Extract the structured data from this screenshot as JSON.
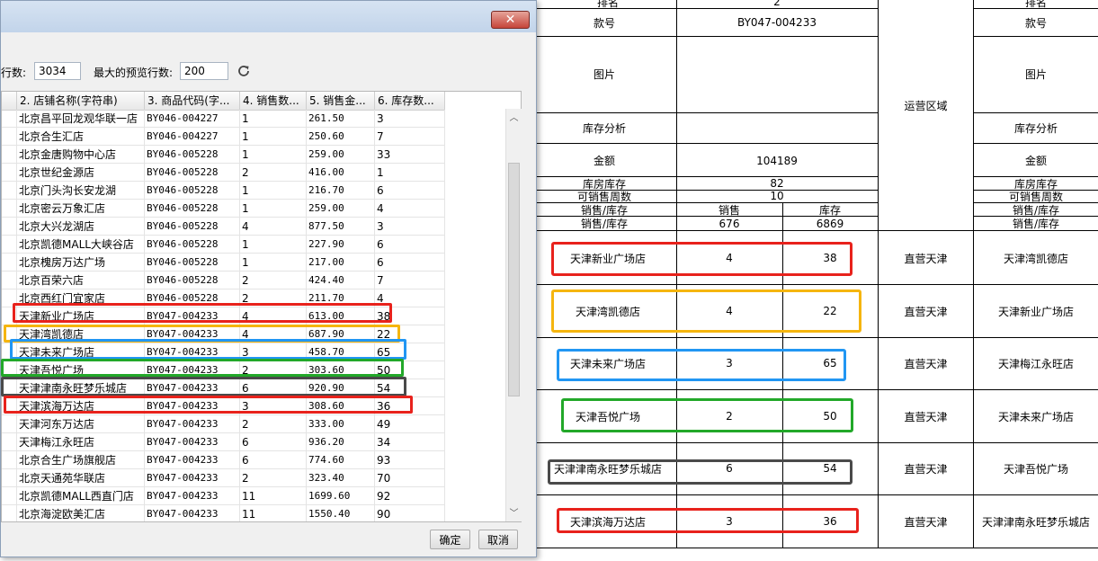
{
  "sheet": {
    "top_row_label": "排名",
    "top_row_value": "2",
    "right_top_label": "排名",
    "model_label": "款号",
    "model_value": "BY047-004233",
    "right_model_label": "款号",
    "picture_label": "图片",
    "right_picture_label": "图片",
    "region_label": "运营区域",
    "stock_analysis_label": "库存分析",
    "right_stock_analysis_label": "库存分析",
    "amount_label": "金额",
    "amount_value": "104189",
    "right_amount_label": "金额",
    "warehouse_stock_label": "库房库存",
    "warehouse_stock_value": "82",
    "right_warehouse_stock_label": "库房库存",
    "weeks_label": "可销售周数",
    "weeks_value": "10",
    "right_weeks_label": "可销售周数",
    "sales_stock_label_1": "销售/库存",
    "sales_header": "销售",
    "stock_header": "库存",
    "right_sales_stock_label_1": "销售/库存",
    "sales_stock_label_2": "销售/库存",
    "sales_total": "676",
    "stock_total": "6869",
    "right_sales_stock_label_2": "销售/库存",
    "stores": [
      {
        "name": "天津新业广场店",
        "sales": "4",
        "stock": "38",
        "region": "直营天津",
        "right": "天津湾凯德店",
        "color": "#e8221c"
      },
      {
        "name": "天津湾凯德店",
        "sales": "4",
        "stock": "22",
        "region": "直营天津",
        "right": "天津新业广场店",
        "color": "#f5b50f"
      },
      {
        "name": "天津未来广场店",
        "sales": "3",
        "stock": "65",
        "region": "直营天津",
        "right": "天津梅江永旺店",
        "color": "#2196f3"
      },
      {
        "name": "天津吾悦广场",
        "sales": "2",
        "stock": "50",
        "region": "直营天津",
        "right": "天津未来广场店",
        "color": "#22a829"
      },
      {
        "name": "天津津南永旺梦乐城店",
        "sales": "6",
        "stock": "54",
        "region": "直营天津",
        "right": "天津吾悦广场",
        "color": "#4a4a4a"
      },
      {
        "name": "天津滨海万达店",
        "sales": "3",
        "stock": "36",
        "region": "直营天津",
        "right": "天津津南永旺梦乐城店",
        "color": "#e8221c"
      }
    ]
  },
  "dialog": {
    "close_label": "✕",
    "rows_label": "行数:",
    "rows_value": "3034",
    "max_preview_label": "最大的预览行数:",
    "max_preview_value": "200",
    "columns": [
      "",
      "2. 店铺名称(字符串)",
      "3. 商品代码(字...",
      "4. 销售数...",
      "5. 销售金...",
      "6. 库存数..."
    ],
    "rows": [
      [
        "北京昌平回龙观华联一店",
        "BY046-004227",
        "1",
        "261.50",
        "3"
      ],
      [
        "北京合生汇店",
        "BY046-004227",
        "1",
        "250.60",
        "7"
      ],
      [
        "北京金唐购物中心店",
        "BY046-005228",
        "1",
        "259.00",
        "33"
      ],
      [
        "北京世纪金源店",
        "BY046-005228",
        "2",
        "416.00",
        "1"
      ],
      [
        "北京门头沟长安龙湖",
        "BY046-005228",
        "1",
        "216.70",
        "6"
      ],
      [
        "北京密云万象汇店",
        "BY046-005228",
        "1",
        "259.00",
        "4"
      ],
      [
        "北京大兴龙湖店",
        "BY046-005228",
        "4",
        "877.50",
        "3"
      ],
      [
        "北京凯德MALL大峡谷店",
        "BY046-005228",
        "1",
        "227.90",
        "6"
      ],
      [
        "北京槐房万达广场",
        "BY046-005228",
        "1",
        "217.00",
        "6"
      ],
      [
        "北京百荣六店",
        "BY046-005228",
        "2",
        "424.40",
        "7"
      ],
      [
        "北京西红门宜家店",
        "BY046-005228",
        "2",
        "211.70",
        "4"
      ],
      [
        "天津新业广场店",
        "BY047-004233",
        "4",
        "613.00",
        "38"
      ],
      [
        "天津湾凯德店",
        "BY047-004233",
        "4",
        "687.90",
        "22"
      ],
      [
        "天津未来广场店",
        "BY047-004233",
        "3",
        "458.70",
        "65"
      ],
      [
        "天津吾悦广场",
        "BY047-004233",
        "2",
        "303.60",
        "50"
      ],
      [
        "天津津南永旺梦乐城店",
        "BY047-004233",
        "6",
        "920.90",
        "54"
      ],
      [
        "天津滨海万达店",
        "BY047-004233",
        "3",
        "308.60",
        "36"
      ],
      [
        "天津河东万达店",
        "BY047-004233",
        "2",
        "333.00",
        "49"
      ],
      [
        "天津梅江永旺店",
        "BY047-004233",
        "6",
        "936.20",
        "34"
      ],
      [
        "北京合生广场旗舰店",
        "BY047-004233",
        "6",
        "774.60",
        "93"
      ],
      [
        "北京天通苑华联店",
        "BY047-004233",
        "2",
        "323.40",
        "70"
      ],
      [
        "北京凯德MALL西直门店",
        "BY047-004233",
        "11",
        "1699.60",
        "92"
      ],
      [
        "北京海淀欧美汇店",
        "BY047-004233",
        "11",
        "1550.40",
        "90"
      ]
    ],
    "ok_label": "确定",
    "cancel_label": "取消"
  }
}
